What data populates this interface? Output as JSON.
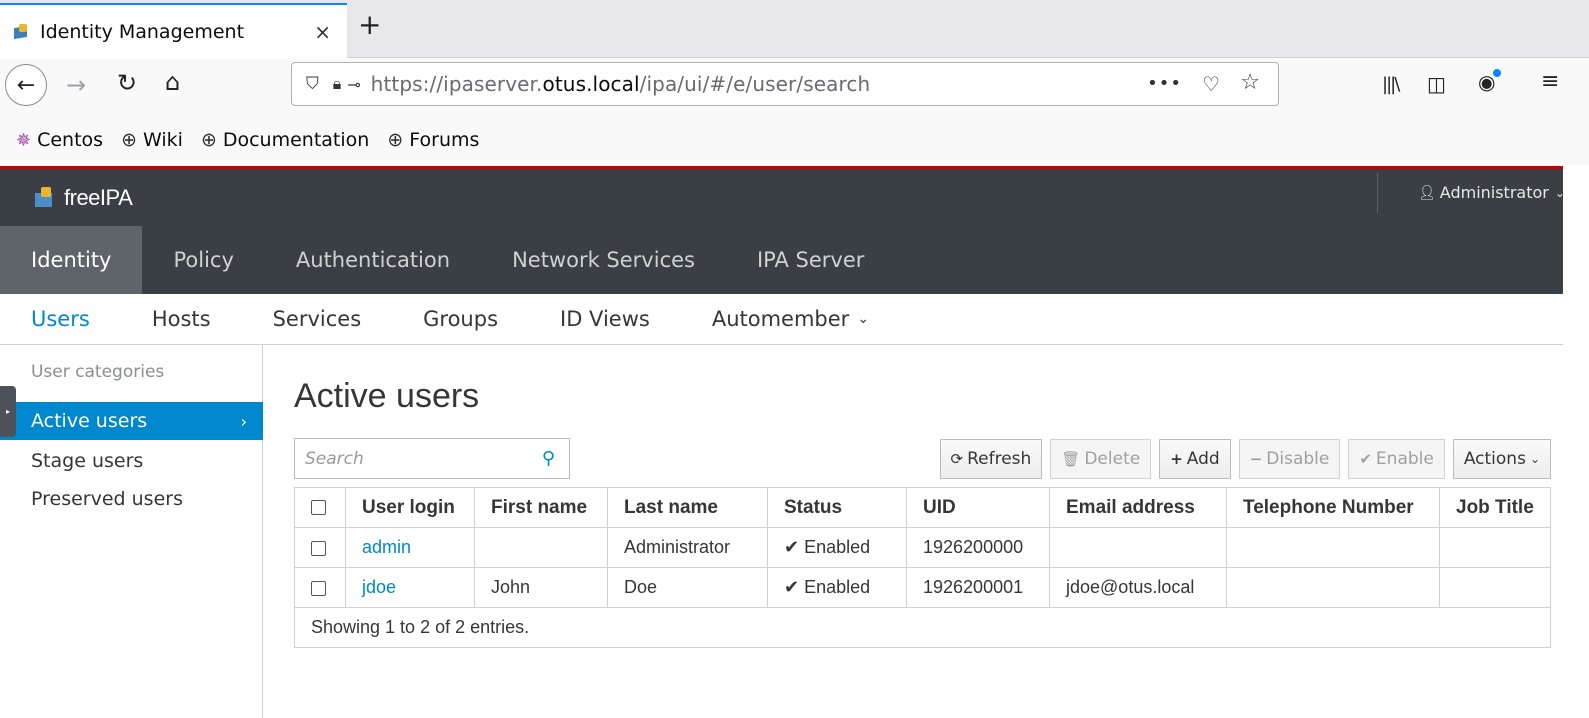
{
  "browser": {
    "tab_title": "Identity Management",
    "tab_close": "×",
    "new_tab": "+",
    "url_prefix": "https://ipaserver.",
    "url_domain": "otus.local",
    "url_path": "/ipa/ui/#/e/user/search",
    "bookmarks": [
      "Centos",
      "Wiki",
      "Documentation",
      "Forums"
    ]
  },
  "ipa": {
    "logo_text": "freeIPA",
    "user_menu": "Administrator",
    "top_nav": [
      "Identity",
      "Policy",
      "Authentication",
      "Network Services",
      "IPA Server"
    ],
    "sub_nav": [
      "Users",
      "Hosts",
      "Services",
      "Groups",
      "ID Views",
      "Automember"
    ],
    "sidebar": {
      "heading": "User categories",
      "items": [
        "Active users",
        "Stage users",
        "Preserved users"
      ]
    },
    "page_title": "Active users",
    "search_placeholder": "Search",
    "buttons": {
      "refresh": "Refresh",
      "delete": "Delete",
      "add": "Add",
      "disable": "Disable",
      "enable": "Enable",
      "actions": "Actions"
    },
    "table": {
      "headers": [
        "User login",
        "First name",
        "Last name",
        "Status",
        "UID",
        "Email address",
        "Telephone Number",
        "Job Title"
      ],
      "rows": [
        {
          "login": "admin",
          "first": "",
          "last": "Administrator",
          "status": "Enabled",
          "uid": "1926200000",
          "email": "",
          "phone": "",
          "title": ""
        },
        {
          "login": "jdoe",
          "first": "John",
          "last": "Doe",
          "status": "Enabled",
          "uid": "1926200001",
          "email": "jdoe@otus.local",
          "phone": "",
          "title": ""
        }
      ],
      "footer": "Showing 1 to 2 of 2 entries."
    }
  }
}
